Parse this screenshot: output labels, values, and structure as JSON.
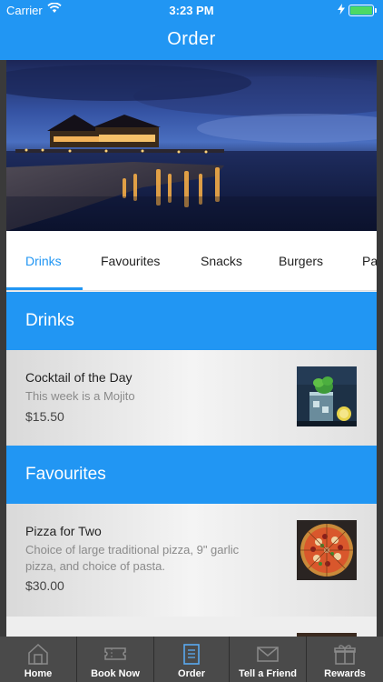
{
  "status": {
    "carrier": "Carrier",
    "time": "3:23 PM"
  },
  "header": {
    "title": "Order"
  },
  "tabs": [
    "Drinks",
    "Favourites",
    "Snacks",
    "Burgers",
    "Pa"
  ],
  "sections": [
    {
      "title": "Drinks",
      "items": [
        {
          "name": "Cocktail of the Day",
          "desc_lines": [
            "This week is a Mojito"
          ],
          "price": "$15.50"
        }
      ]
    },
    {
      "title": "Favourites",
      "items": [
        {
          "name": "Pizza for Two",
          "desc_lines": [
            "Choice of large traditional pizza, 9\" garlic",
            "pizza, and choice of pasta."
          ],
          "price": "$30.00"
        }
      ]
    }
  ],
  "tabbar": {
    "items": [
      {
        "label": "Home",
        "icon": "home-icon"
      },
      {
        "label": "Book Now",
        "icon": "ticket-icon"
      },
      {
        "label": "Order",
        "icon": "menu-book-icon"
      },
      {
        "label": "Tell a Friend",
        "icon": "mail-icon"
      },
      {
        "label": "Rewards",
        "icon": "gift-icon"
      }
    ],
    "active_index": 2
  },
  "colors": {
    "primary": "#2196f3",
    "tabbar": "#4a4a4a",
    "active_tab_icon": "#5aa9f0"
  }
}
